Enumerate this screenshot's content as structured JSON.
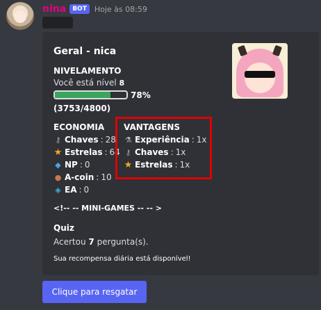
{
  "message": {
    "username": "nina",
    "bot_tag": "BOT",
    "timestamp": "Hoje às 08:59"
  },
  "embed": {
    "title": "Geral - nica",
    "nivelamento": {
      "heading": "NIVELAMENTO",
      "level_text": "Você está nível",
      "level": "8",
      "progress_percent": 78,
      "progress_label": "78%",
      "xp": "(3753/4800)"
    },
    "economia": {
      "heading": "ECONOMIA",
      "items": [
        {
          "icon": "key-icon",
          "label": "Chaves",
          "value": "28"
        },
        {
          "icon": "star-icon",
          "label": "Estrelas",
          "value": "64"
        },
        {
          "icon": "flame-icon",
          "label": "NP",
          "value": "0"
        },
        {
          "icon": "coin-icon",
          "label": "A-coin",
          "value": "10"
        },
        {
          "icon": "ea-icon",
          "label": "EA",
          "value": "0"
        }
      ]
    },
    "vantagens": {
      "heading": "VANTAGENS",
      "items": [
        {
          "icon": "experience-icon",
          "label": "Experiência",
          "value": "1x"
        },
        {
          "icon": "key-icon",
          "label": "Chaves",
          "value": "1x"
        },
        {
          "icon": "star-icon",
          "label": "Estrelas",
          "value": "1x"
        }
      ]
    },
    "minigames": "<!-- -- MINI-GAMES -- -- >",
    "quiz": {
      "heading": "Quiz",
      "text_before": "Acertou",
      "count": "7",
      "text_after": "pergunta(s)."
    },
    "daily_reward": "Sua recompensa diária está disponível!"
  },
  "claim_button": "Clique para resgatar",
  "colors": {
    "accent": "#5865f2",
    "progress": "#3ba55d",
    "highlight": "#e00000",
    "username": "#e6007e"
  }
}
